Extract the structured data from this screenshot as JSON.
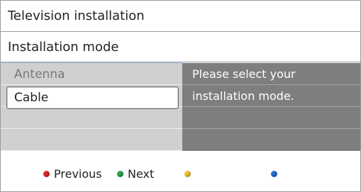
{
  "header": {
    "title": "Television installation"
  },
  "section": {
    "title": "Installation mode"
  },
  "menu": {
    "items": [
      {
        "label": "Antenna",
        "selected": false
      },
      {
        "label": "Cable",
        "selected": true
      }
    ]
  },
  "info": {
    "lines": [
      "Please select your",
      "installation mode."
    ]
  },
  "footer": {
    "buttons": [
      {
        "label": "Previous",
        "color": "#e12b2b"
      },
      {
        "label": "Next",
        "color": "#2aa84a"
      },
      {
        "label": "",
        "color": "#f2c230"
      },
      {
        "label": "",
        "color": "#2a6fd6"
      }
    ]
  }
}
